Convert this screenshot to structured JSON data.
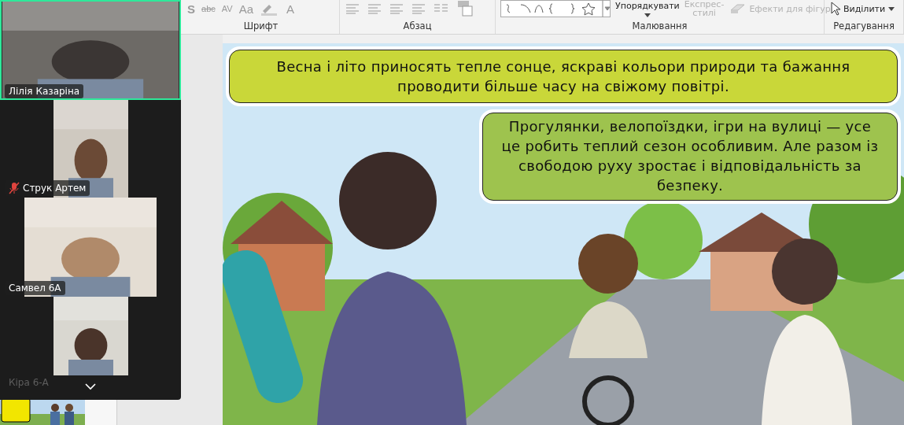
{
  "ribbon": {
    "font_glyphs": [
      "S",
      "abc",
      "AV",
      "Aa",
      "A"
    ],
    "groups": [
      {
        "label": "Шрифт"
      },
      {
        "label": "Абзац"
      },
      {
        "label": "Малювання"
      },
      {
        "label": "Редагування"
      }
    ],
    "arrange": "Упорядкувати",
    "quick_styles": [
      "Експрес-",
      "стилі"
    ],
    "shape_effects": "Ефекти для фігур",
    "select": "Виділити"
  },
  "participants": [
    {
      "name": "Лілія Казаріна",
      "active": true,
      "muted": false,
      "dimmed": false
    },
    {
      "name": "Струк Артем",
      "active": false,
      "muted": true,
      "dimmed": false
    },
    {
      "name": "Самвел 6А",
      "active": false,
      "muted": false,
      "dimmed": false
    },
    {
      "name": "Кіра 6-А",
      "active": false,
      "muted": false,
      "dimmed": true
    }
  ],
  "slide": {
    "callouts": [
      "Весна і літо приносять тепле сонце, яскраві кольори природи та бажання проводити більше часу на свіжому повітрі.",
      "Прогулянки, велопоїздки, ігри на вулиці — усе це робить теплий сезон особливим. Але разом із свободою руху зростає і відповідальність за безпеку."
    ]
  }
}
